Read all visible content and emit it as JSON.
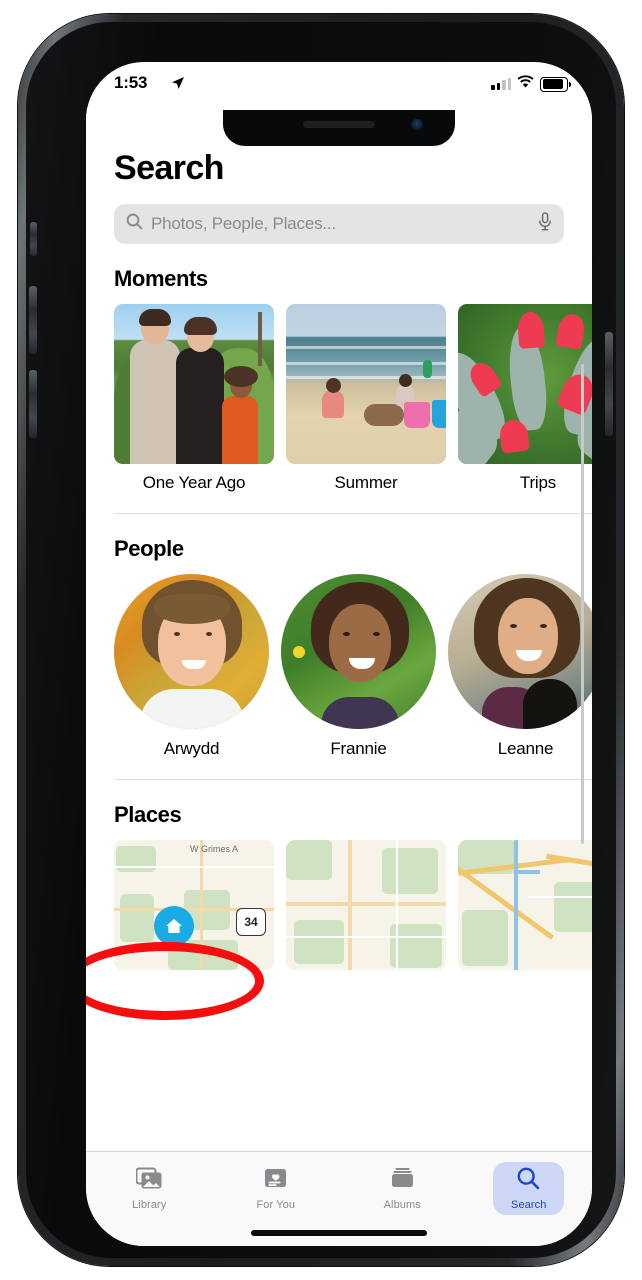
{
  "status_bar": {
    "time": "1:53",
    "location_icon": "location-arrow-icon",
    "signal_icon": "cellular-bars-icon",
    "wifi_icon": "wifi-icon",
    "battery_icon": "battery-full-icon"
  },
  "page": {
    "title": "Search"
  },
  "search": {
    "placeholder": "Photos, People, Places...",
    "value": "",
    "search_icon": "magnifier-icon",
    "mic_icon": "microphone-icon"
  },
  "sections": {
    "moments": {
      "heading": "Moments",
      "items": [
        {
          "label": "One Year Ago",
          "art": "family-outdoors"
        },
        {
          "label": "Summer",
          "art": "beach"
        },
        {
          "label": "Trips",
          "art": "red-succulent-flowers"
        },
        {
          "label": "",
          "art": "partial"
        }
      ]
    },
    "people": {
      "heading": "People",
      "items": [
        {
          "label": "Arwydd",
          "art": "girl-autumn"
        },
        {
          "label": "Frannie",
          "art": "girl-green"
        },
        {
          "label": "Leanne",
          "art": "teen-cat"
        },
        {
          "label": "",
          "art": "partial"
        }
      ]
    },
    "places": {
      "heading": "Places",
      "highlighted": true,
      "highlight_color": "#f60d0d",
      "items": [
        {
          "label": "W Grimes A",
          "home_pin": "home-pin-icon",
          "route_shield": "34"
        },
        {
          "label": ""
        },
        {
          "label": ""
        },
        {
          "label": ""
        }
      ]
    }
  },
  "tab_bar": {
    "active": "Search",
    "active_color": "#1f45cf",
    "active_pill_color": "#ccd8f5",
    "inactive_color": "#8a8a8e",
    "tabs": [
      {
        "label": "Library",
        "icon": "photo-stack-icon"
      },
      {
        "label": "For You",
        "icon": "heart-card-icon"
      },
      {
        "label": "Albums",
        "icon": "albums-folder-icon"
      },
      {
        "label": "Search",
        "icon": "magnifier-icon"
      }
    ]
  }
}
